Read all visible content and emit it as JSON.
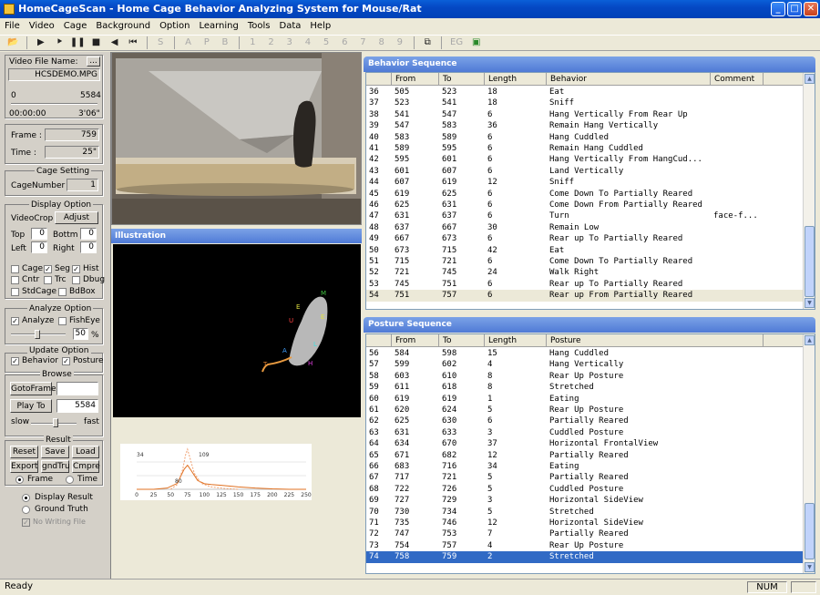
{
  "window": {
    "title": "HomeCageScan - Home Cage Behavior Analyzing System for Mouse/Rat",
    "minimize": "_",
    "maximize": "□",
    "close": "✕"
  },
  "menu": [
    "File",
    "Video",
    "Cage",
    "Background",
    "Option",
    "Learning",
    "Tools",
    "Data",
    "Help"
  ],
  "toolbar": {
    "open_icon": "folder-open-icon",
    "play": "▶",
    "play_step": "⯈",
    "pause": "❚❚",
    "stop": "■",
    "rewind": "◀",
    "rewind_start": "⏮",
    "modes": [
      "S",
      "A",
      "P",
      "B",
      "1",
      "2",
      "3",
      "4",
      "5",
      "6",
      "7",
      "8",
      "9"
    ],
    "eg": "EG"
  },
  "left": {
    "video_file_label": "Video File Name:",
    "browse_button": "...",
    "video_file": "HCSDEMO.MPG",
    "frame_range_start": "0",
    "frame_range_end": "5584",
    "time_start": "00:00:00",
    "time_end": "3'06\"",
    "frame_label": "Frame :",
    "frame_value": "759",
    "time_label": "Time :",
    "time_value": "25\"",
    "cage_setting_title": "Cage Setting",
    "cage_number_label": "CageNumber",
    "cage_number_value": "1",
    "display_option_title": "Display Option",
    "videocrop_label": "VideoCrop",
    "adjust_button": "Adjust",
    "top_label": "Top",
    "top_value": "0",
    "bottom_label": "Bottm",
    "bottom_value": "0",
    "left_label": "Left",
    "left_value": "0",
    "right_label": "Right",
    "right_value": "0",
    "checks": [
      {
        "label": "Cage",
        "checked": false
      },
      {
        "label": "Seg",
        "checked": true
      },
      {
        "label": "Hist",
        "checked": true
      },
      {
        "label": "Cntr",
        "checked": false
      },
      {
        "label": "Trc",
        "checked": false
      },
      {
        "label": "Dbug",
        "checked": false
      },
      {
        "label": "StdCage",
        "checked": false
      },
      {
        "label": "BdBox",
        "checked": false
      }
    ],
    "analyze_option_title": "Analyze Option",
    "analyze_label": "Analyze",
    "fisheye_label": "FishEye",
    "fisheye_value": "50",
    "percent": "%",
    "update_option_title": "Update Option",
    "behavior_label": "Behavior",
    "posture_label": "Posture",
    "browse_title": "Browse",
    "gotoframe_button": "GotoFrame",
    "playto_button": "Play To",
    "playto_value": "5584",
    "slow_label": "slow",
    "fast_label": "fast",
    "result_title": "Result",
    "buttons_row1": [
      "Reset",
      "Save",
      "Load"
    ],
    "buttons_row2": [
      "Export",
      "gndTru",
      "Cmpre"
    ],
    "frame_radio": "Frame",
    "time_radio": "Time",
    "display_result": "Display Result",
    "ground_truth": "Ground Truth",
    "no_writing": "No Writing File"
  },
  "illustration": {
    "title": "Illustration",
    "body_labels": [
      "M",
      "E",
      "U",
      "A",
      "L",
      "H",
      "T",
      "E"
    ]
  },
  "chart_data": {
    "type": "line",
    "x_ticks": [
      0,
      25,
      50,
      75,
      100,
      125,
      150,
      175,
      200,
      225,
      250
    ],
    "annotations": [
      "34",
      "109",
      "80"
    ],
    "series": [
      {
        "style": "solid",
        "color": "#e07020",
        "values": [
          [
            0,
            0
          ],
          [
            25,
            0
          ],
          [
            45,
            3
          ],
          [
            60,
            15
          ],
          [
            70,
            50
          ],
          [
            75,
            60
          ],
          [
            80,
            48
          ],
          [
            90,
            22
          ],
          [
            100,
            14
          ],
          [
            110,
            12
          ],
          [
            125,
            10
          ],
          [
            150,
            6
          ],
          [
            175,
            3
          ],
          [
            200,
            1
          ],
          [
            225,
            0
          ],
          [
            250,
            0
          ]
        ]
      },
      {
        "style": "dashed",
        "color": "#f0a070",
        "values": [
          [
            50,
            0
          ],
          [
            60,
            12
          ],
          [
            68,
            50
          ],
          [
            72,
            85
          ],
          [
            75,
            100
          ],
          [
            78,
            82
          ],
          [
            85,
            40
          ],
          [
            95,
            15
          ],
          [
            110,
            6
          ],
          [
            130,
            2
          ],
          [
            150,
            0
          ]
        ]
      }
    ]
  },
  "behavior": {
    "title": "Behavior Sequence",
    "columns": [
      "From",
      "To",
      "Length",
      "Behavior",
      "Comment"
    ],
    "rows": [
      [
        "36",
        "505",
        "523",
        "18",
        "Eat",
        ""
      ],
      [
        "37",
        "523",
        "541",
        "18",
        "Sniff",
        ""
      ],
      [
        "38",
        "541",
        "547",
        "6",
        "Hang Vertically From Rear Up",
        ""
      ],
      [
        "39",
        "547",
        "583",
        "36",
        "Remain Hang Vertically",
        ""
      ],
      [
        "40",
        "583",
        "589",
        "6",
        "Hang Cuddled",
        ""
      ],
      [
        "41",
        "589",
        "595",
        "6",
        "Remain Hang Cuddled",
        ""
      ],
      [
        "42",
        "595",
        "601",
        "6",
        "Hang Vertically From HangCud...",
        ""
      ],
      [
        "43",
        "601",
        "607",
        "6",
        "Land Vertically",
        ""
      ],
      [
        "44",
        "607",
        "619",
        "12",
        "Sniff",
        ""
      ],
      [
        "45",
        "619",
        "625",
        "6",
        "Come Down To Partially Reared",
        ""
      ],
      [
        "46",
        "625",
        "631",
        "6",
        "Come Down From Partially Reared",
        ""
      ],
      [
        "47",
        "631",
        "637",
        "6",
        "Turn",
        "face-f..."
      ],
      [
        "48",
        "637",
        "667",
        "30",
        "Remain Low",
        ""
      ],
      [
        "49",
        "667",
        "673",
        "6",
        "Rear up To Partially Reared",
        ""
      ],
      [
        "50",
        "673",
        "715",
        "42",
        "Eat",
        ""
      ],
      [
        "51",
        "715",
        "721",
        "6",
        "Come Down To Partially Reared",
        ""
      ],
      [
        "52",
        "721",
        "745",
        "24",
        "Walk Right",
        ""
      ],
      [
        "53",
        "745",
        "751",
        "6",
        "Rear up To Partially Reared",
        ""
      ],
      [
        "54",
        "751",
        "757",
        "6",
        "Rear up From Partially Reared",
        ""
      ]
    ]
  },
  "posture": {
    "title": "Posture Sequence",
    "columns": [
      "From",
      "To",
      "Length",
      "Posture"
    ],
    "rows": [
      [
        "56",
        "584",
        "598",
        "15",
        "Hang Cuddled"
      ],
      [
        "57",
        "599",
        "602",
        "4",
        "Hang Vertically"
      ],
      [
        "58",
        "603",
        "610",
        "8",
        "Rear Up Posture"
      ],
      [
        "59",
        "611",
        "618",
        "8",
        "Stretched"
      ],
      [
        "60",
        "619",
        "619",
        "1",
        "Eating"
      ],
      [
        "61",
        "620",
        "624",
        "5",
        "Rear Up Posture"
      ],
      [
        "62",
        "625",
        "630",
        "6",
        "Partially Reared"
      ],
      [
        "63",
        "631",
        "633",
        "3",
        "Cuddled Posture"
      ],
      [
        "64",
        "634",
        "670",
        "37",
        "Horizontal FrontalView"
      ],
      [
        "65",
        "671",
        "682",
        "12",
        "Partially Reared"
      ],
      [
        "66",
        "683",
        "716",
        "34",
        "Eating"
      ],
      [
        "67",
        "717",
        "721",
        "5",
        "Partially Reared"
      ],
      [
        "68",
        "722",
        "726",
        "5",
        "Cuddled Posture"
      ],
      [
        "69",
        "727",
        "729",
        "3",
        "Horizontal SideView"
      ],
      [
        "70",
        "730",
        "734",
        "5",
        "Stretched"
      ],
      [
        "71",
        "735",
        "746",
        "12",
        "Horizontal SideView"
      ],
      [
        "72",
        "747",
        "753",
        "7",
        "Partially Reared"
      ],
      [
        "73",
        "754",
        "757",
        "4",
        "Rear Up Posture"
      ],
      [
        "74",
        "758",
        "759",
        "2",
        "Stretched"
      ]
    ]
  },
  "status": {
    "text": "Ready",
    "num": "NUM"
  }
}
